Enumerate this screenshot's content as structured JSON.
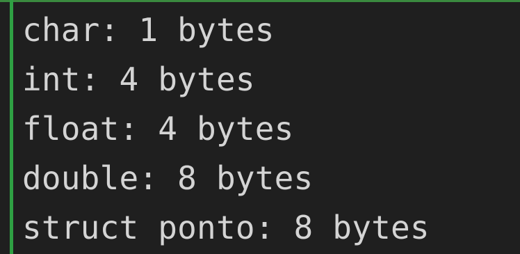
{
  "terminal": {
    "accent_color": "#2ea043",
    "background_color": "#1f1f1f",
    "text_color": "#d4d4d4",
    "lines": [
      "char: 1 bytes",
      "int: 4 bytes",
      "float: 4 bytes",
      "double: 8 bytes",
      "struct ponto: 8 bytes"
    ]
  }
}
